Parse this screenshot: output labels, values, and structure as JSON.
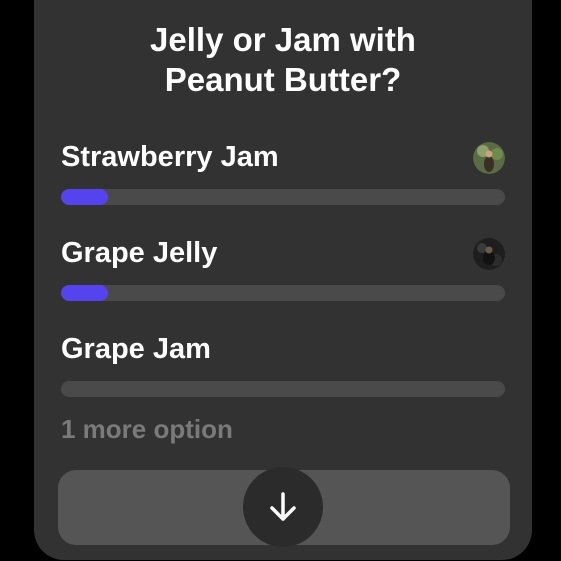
{
  "poll": {
    "title_line1": "Jelly or Jam with",
    "title_line2": "Peanut Butter?",
    "options": [
      {
        "label": "Strawberry Jam",
        "fill_fraction": 0.105,
        "has_avatar": true
      },
      {
        "label": "Grape Jelly",
        "fill_fraction": 0.105,
        "has_avatar": true
      },
      {
        "label": "Grape Jam",
        "fill_fraction": 0.0,
        "has_avatar": false
      }
    ],
    "more_options_label": "1 more option"
  },
  "colors": {
    "background": "#000000",
    "card": "#323232",
    "track": "#4a4a4a",
    "fill": "#5543ee",
    "muted_text": "#7a7a7a",
    "vote_bar": "#555555"
  },
  "icons": {
    "scroll_button": "arrow-down-icon"
  }
}
